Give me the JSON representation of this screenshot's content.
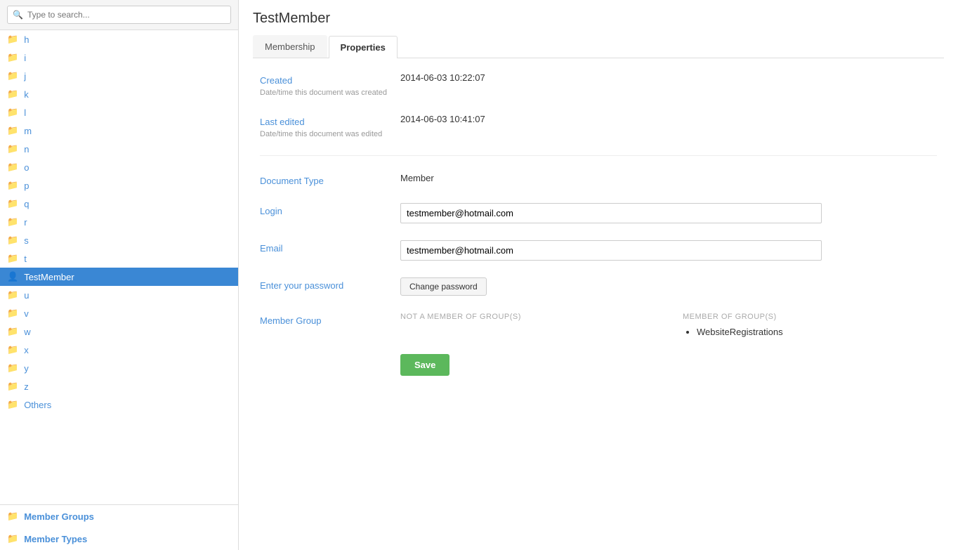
{
  "sidebar": {
    "search_placeholder": "Type to search...",
    "items": [
      {
        "label": "h",
        "type": "folder",
        "active": false
      },
      {
        "label": "i",
        "type": "folder",
        "active": false
      },
      {
        "label": "j",
        "type": "folder",
        "active": false
      },
      {
        "label": "k",
        "type": "folder",
        "active": false
      },
      {
        "label": "l",
        "type": "folder",
        "active": false
      },
      {
        "label": "m",
        "type": "folder",
        "active": false
      },
      {
        "label": "n",
        "type": "folder",
        "active": false
      },
      {
        "label": "o",
        "type": "folder",
        "active": false
      },
      {
        "label": "p",
        "type": "folder",
        "active": false
      },
      {
        "label": "q",
        "type": "folder",
        "active": false
      },
      {
        "label": "r",
        "type": "folder",
        "active": false
      },
      {
        "label": "s",
        "type": "folder",
        "active": false
      },
      {
        "label": "t",
        "type": "folder",
        "active": false
      },
      {
        "label": "TestMember",
        "type": "user",
        "active": true
      },
      {
        "label": "u",
        "type": "folder",
        "active": false
      },
      {
        "label": "v",
        "type": "folder",
        "active": false
      },
      {
        "label": "w",
        "type": "folder",
        "active": false
      },
      {
        "label": "x",
        "type": "folder",
        "active": false
      },
      {
        "label": "y",
        "type": "folder",
        "active": false
      },
      {
        "label": "z",
        "type": "folder",
        "active": false
      },
      {
        "label": "Others",
        "type": "folder",
        "active": false
      }
    ],
    "sections": [
      {
        "label": "Member Groups"
      },
      {
        "label": "Member Types"
      }
    ]
  },
  "page": {
    "title": "TestMember",
    "tabs": [
      {
        "label": "Membership",
        "active": false
      },
      {
        "label": "Properties",
        "active": true
      }
    ]
  },
  "fields": {
    "created": {
      "label": "Created",
      "sublabel": "Date/time this document was created",
      "value": "2014-06-03 10:22:07"
    },
    "last_edited": {
      "label": "Last edited",
      "sublabel": "Date/time this document was edited",
      "value": "2014-06-03 10:41:07"
    },
    "document_type": {
      "label": "Document Type",
      "value": "Member"
    },
    "login": {
      "label": "Login",
      "value": "testmember@hotmail.com"
    },
    "email": {
      "label": "Email",
      "value": "testmember@hotmail.com"
    },
    "password": {
      "label": "Enter your password",
      "button_label": "Change password"
    },
    "member_group": {
      "label": "Member Group",
      "not_member_title": "NOT A MEMBER OF GROUP(S)",
      "member_title": "MEMBER OF GROUP(S)",
      "member_of": [
        "WebsiteRegistrations"
      ]
    }
  },
  "buttons": {
    "save": "Save"
  }
}
